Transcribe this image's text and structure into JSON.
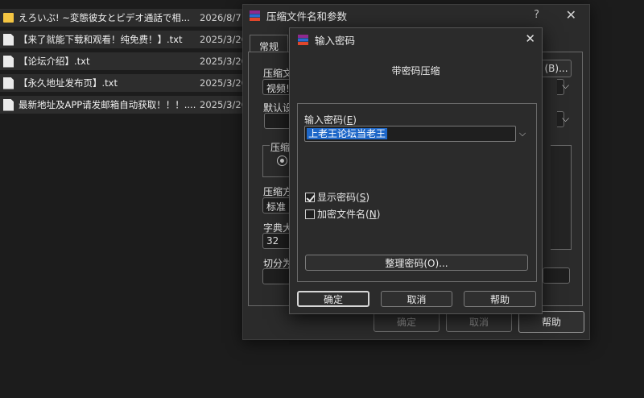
{
  "files": [
    {
      "name": "えろいぶ! ~変態彼女とビデオ通話で相...",
      "date": "2026/8/7",
      "icon": "folder-icon"
    },
    {
      "name": "【来了就能下载和观看！纯免费！】.txt",
      "date": "2025/3/26",
      "icon": "text-file-icon"
    },
    {
      "name": "【论坛介绍】.txt",
      "date": "2025/3/26",
      "icon": "text-file-icon"
    },
    {
      "name": "【永久地址发布页】.txt",
      "date": "2025/3/26",
      "icon": "text-file-icon"
    },
    {
      "name": "最新地址及APP请发邮箱自动获取！！！....",
      "date": "2025/3/26",
      "icon": "text-file-icon"
    }
  ],
  "archive_dialog": {
    "title": "压缩文件名和参数",
    "help_mark": "?",
    "tab_general": "常规",
    "archive_name_label": "压缩文",
    "archive_name_value": "视频!",
    "browse_label": "(B)...",
    "default_profile_label": "默认设",
    "format_group_label": "压缩文",
    "method_label": "压缩方",
    "method_value": "标准",
    "dict_label": "字典大",
    "dict_value": "32",
    "split_label": "切分为",
    "ok": "确定",
    "cancel": "取消",
    "help": "帮助"
  },
  "password_dialog": {
    "title": "输入密码",
    "heading": "带密码压缩",
    "password_label": "输入密码",
    "password_hotkey": "E",
    "password_value": "上老王论坛当老王",
    "show_password_label": "显示密码",
    "show_password_hotkey": "S",
    "show_password_checked": true,
    "encrypt_names_label": "加密文件名",
    "encrypt_names_hotkey": "N",
    "encrypt_names_checked": false,
    "organize_button": "整理密码(O)...",
    "ok": "确定",
    "cancel": "取消",
    "help": "帮助"
  },
  "colors": {
    "selection": "#1e67c8",
    "dialog_bg": "#2b2b2b",
    "desktop_bg": "#1c1c1c"
  }
}
